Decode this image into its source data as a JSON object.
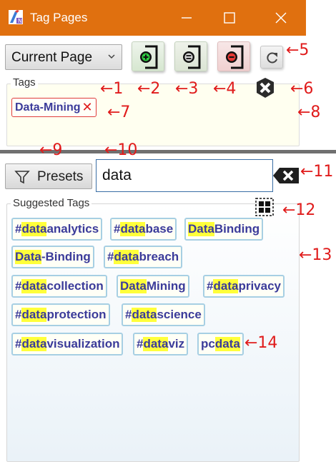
{
  "window": {
    "title": "Tag Pages",
    "minimize_glyph": "minimize-icon",
    "maximize_glyph": "maximize-icon",
    "close_glyph": "close-icon"
  },
  "toolbar": {
    "scope_dropdown": "Current Page",
    "add_button_icon": "add-tag-icon",
    "replace_button_icon": "replace-tags-icon",
    "remove_button_icon": "remove-tag-icon",
    "refresh_button_icon": "refresh-icon"
  },
  "tags_section": {
    "label": "Tags",
    "clear_icon": "clear-tags-icon",
    "tags": [
      {
        "text": "Data-Mining",
        "remove": "✕"
      }
    ]
  },
  "filter": {
    "presets_label": "Presets",
    "search_value": "data",
    "clear_icon": "clear-search-icon"
  },
  "suggested": {
    "label": "Suggested Tags",
    "toggle_icon": "grid-select-icon",
    "chips": [
      {
        "pre": "#",
        "hl": "data",
        "post": "analytics"
      },
      {
        "pre": "#",
        "hl": "data",
        "post": "base"
      },
      {
        "pre": "",
        "hl": "Data",
        "post": " Binding"
      },
      {
        "pre": "",
        "hl": "Data",
        "post": "-Binding"
      },
      {
        "pre": "#",
        "hl": "data",
        "post": "breach"
      },
      {
        "pre": "#",
        "hl": "data",
        "post": "collection"
      },
      {
        "pre": "",
        "hl": "Data",
        "post": " Mining"
      },
      {
        "pre": "#",
        "hl": "data",
        "post": "privacy"
      },
      {
        "pre": "#",
        "hl": "data",
        "post": "protection"
      },
      {
        "pre": "#",
        "hl": "data",
        "post": "science"
      },
      {
        "pre": "#",
        "hl": "data",
        "post": "visualization"
      },
      {
        "pre": "#",
        "hl": "data",
        "post": "viz"
      },
      {
        "pre": "pc",
        "hl": "data",
        "post": ""
      }
    ]
  },
  "callouts": {
    "c1": "←1",
    "c2": "←2",
    "c3": "←3",
    "c4": "←4",
    "c5": "←5",
    "c6": "←6",
    "c7": "←7",
    "c8": "←8",
    "c9": "←9",
    "c10": "←10",
    "c11": "←11",
    "c12": "←12",
    "c13": "←13",
    "c14": "←14"
  },
  "colors": {
    "titlebar": "#e0700f",
    "tag_text": "#3b3b9a",
    "highlight": "#ffff3a",
    "callout": "#e01b1b",
    "chip_border": "#a7cfe3"
  }
}
